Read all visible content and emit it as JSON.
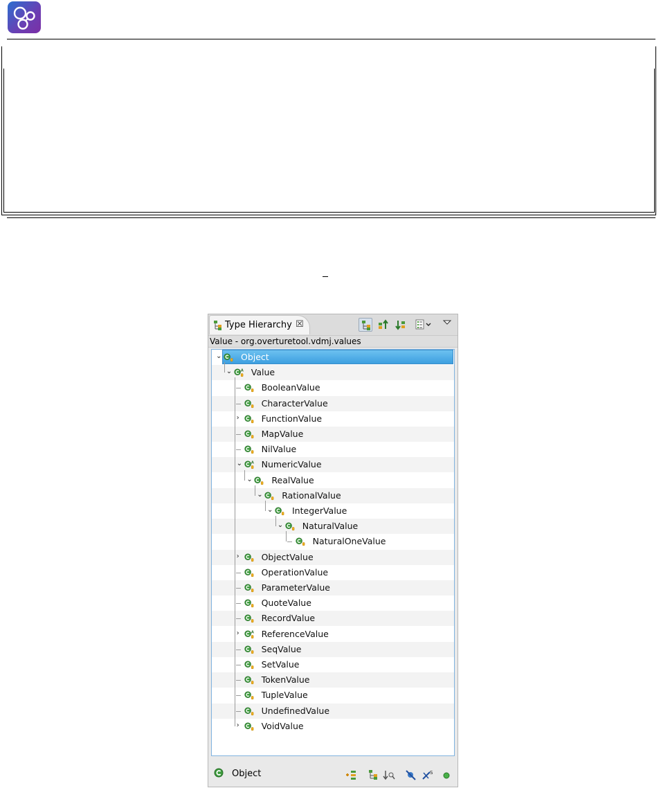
{
  "page": {
    "logo": "overture-logo"
  },
  "view": {
    "tab_title": "Type Hierarchy",
    "tab_close": "☒",
    "status": "Value - org.overturetool.vdmj.values",
    "toolbar": [
      "type-hierarchy-icon",
      "supertype-hierarchy-icon",
      "subtype-hierarchy-icon",
      "history-icon",
      "view-menu-icon"
    ],
    "tree": [
      {
        "label": "Object",
        "level": 0,
        "expanded": true,
        "abstract": false,
        "selected": true
      },
      {
        "label": "Value",
        "level": 1,
        "expanded": true,
        "abstract": true
      },
      {
        "label": "BooleanValue",
        "level": 2
      },
      {
        "label": "CharacterValue",
        "level": 2
      },
      {
        "label": "FunctionValue",
        "level": 2,
        "collapsed": true
      },
      {
        "label": "MapValue",
        "level": 2
      },
      {
        "label": "NilValue",
        "level": 2
      },
      {
        "label": "NumericValue",
        "level": 2,
        "expanded": true,
        "abstract": true
      },
      {
        "label": "RealValue",
        "level": 3,
        "expanded": true
      },
      {
        "label": "RationalValue",
        "level": 4,
        "expanded": true
      },
      {
        "label": "IntegerValue",
        "level": 5,
        "expanded": true
      },
      {
        "label": "NaturalValue",
        "level": 6,
        "expanded": true
      },
      {
        "label": "NaturalOneValue",
        "level": 7
      },
      {
        "label": "ObjectValue",
        "level": 2,
        "collapsed": true
      },
      {
        "label": "OperationValue",
        "level": 2
      },
      {
        "label": "ParameterValue",
        "level": 2
      },
      {
        "label": "QuoteValue",
        "level": 2
      },
      {
        "label": "RecordValue",
        "level": 2
      },
      {
        "label": "ReferenceValue",
        "level": 2,
        "collapsed": true,
        "abstract": true
      },
      {
        "label": "SeqValue",
        "level": 2
      },
      {
        "label": "SetValue",
        "level": 2
      },
      {
        "label": "TokenValue",
        "level": 2
      },
      {
        "label": "TupleValue",
        "level": 2
      },
      {
        "label": "UndefinedValue",
        "level": 2
      },
      {
        "label": "VoidValue",
        "level": 2,
        "collapsed": true
      }
    ],
    "bottom": {
      "label": "Object",
      "icons": [
        "inherited-members-icon",
        "sort-by-type-icon",
        "lock-view-icon",
        "hide-fields-icon",
        "hide-static-icon",
        "hide-non-public-icon"
      ]
    }
  }
}
